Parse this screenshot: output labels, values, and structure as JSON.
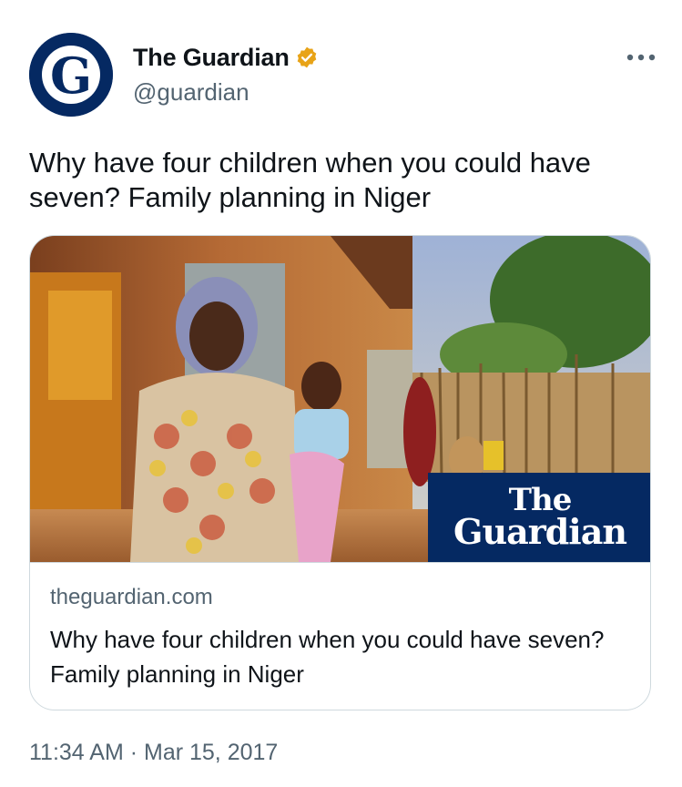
{
  "author": {
    "display_name": "The Guardian",
    "handle": "@guardian",
    "avatar_letter": "G",
    "avatar_color": "#052962",
    "verified_badge_color": "#e8a317"
  },
  "tweet": {
    "text": "Why have four children when you could have seven? Family planning in Niger",
    "timestamp": "11:34 AM · Mar 15, 2017"
  },
  "card": {
    "domain": "theguardian.com",
    "title": "Why have four children when you could have seven? Family planning in Niger",
    "image_logo_line1": "The",
    "image_logo_line2": "Guardian"
  },
  "icons": {
    "more": "more-horizontal-icon",
    "verified": "verified-badge-icon"
  }
}
